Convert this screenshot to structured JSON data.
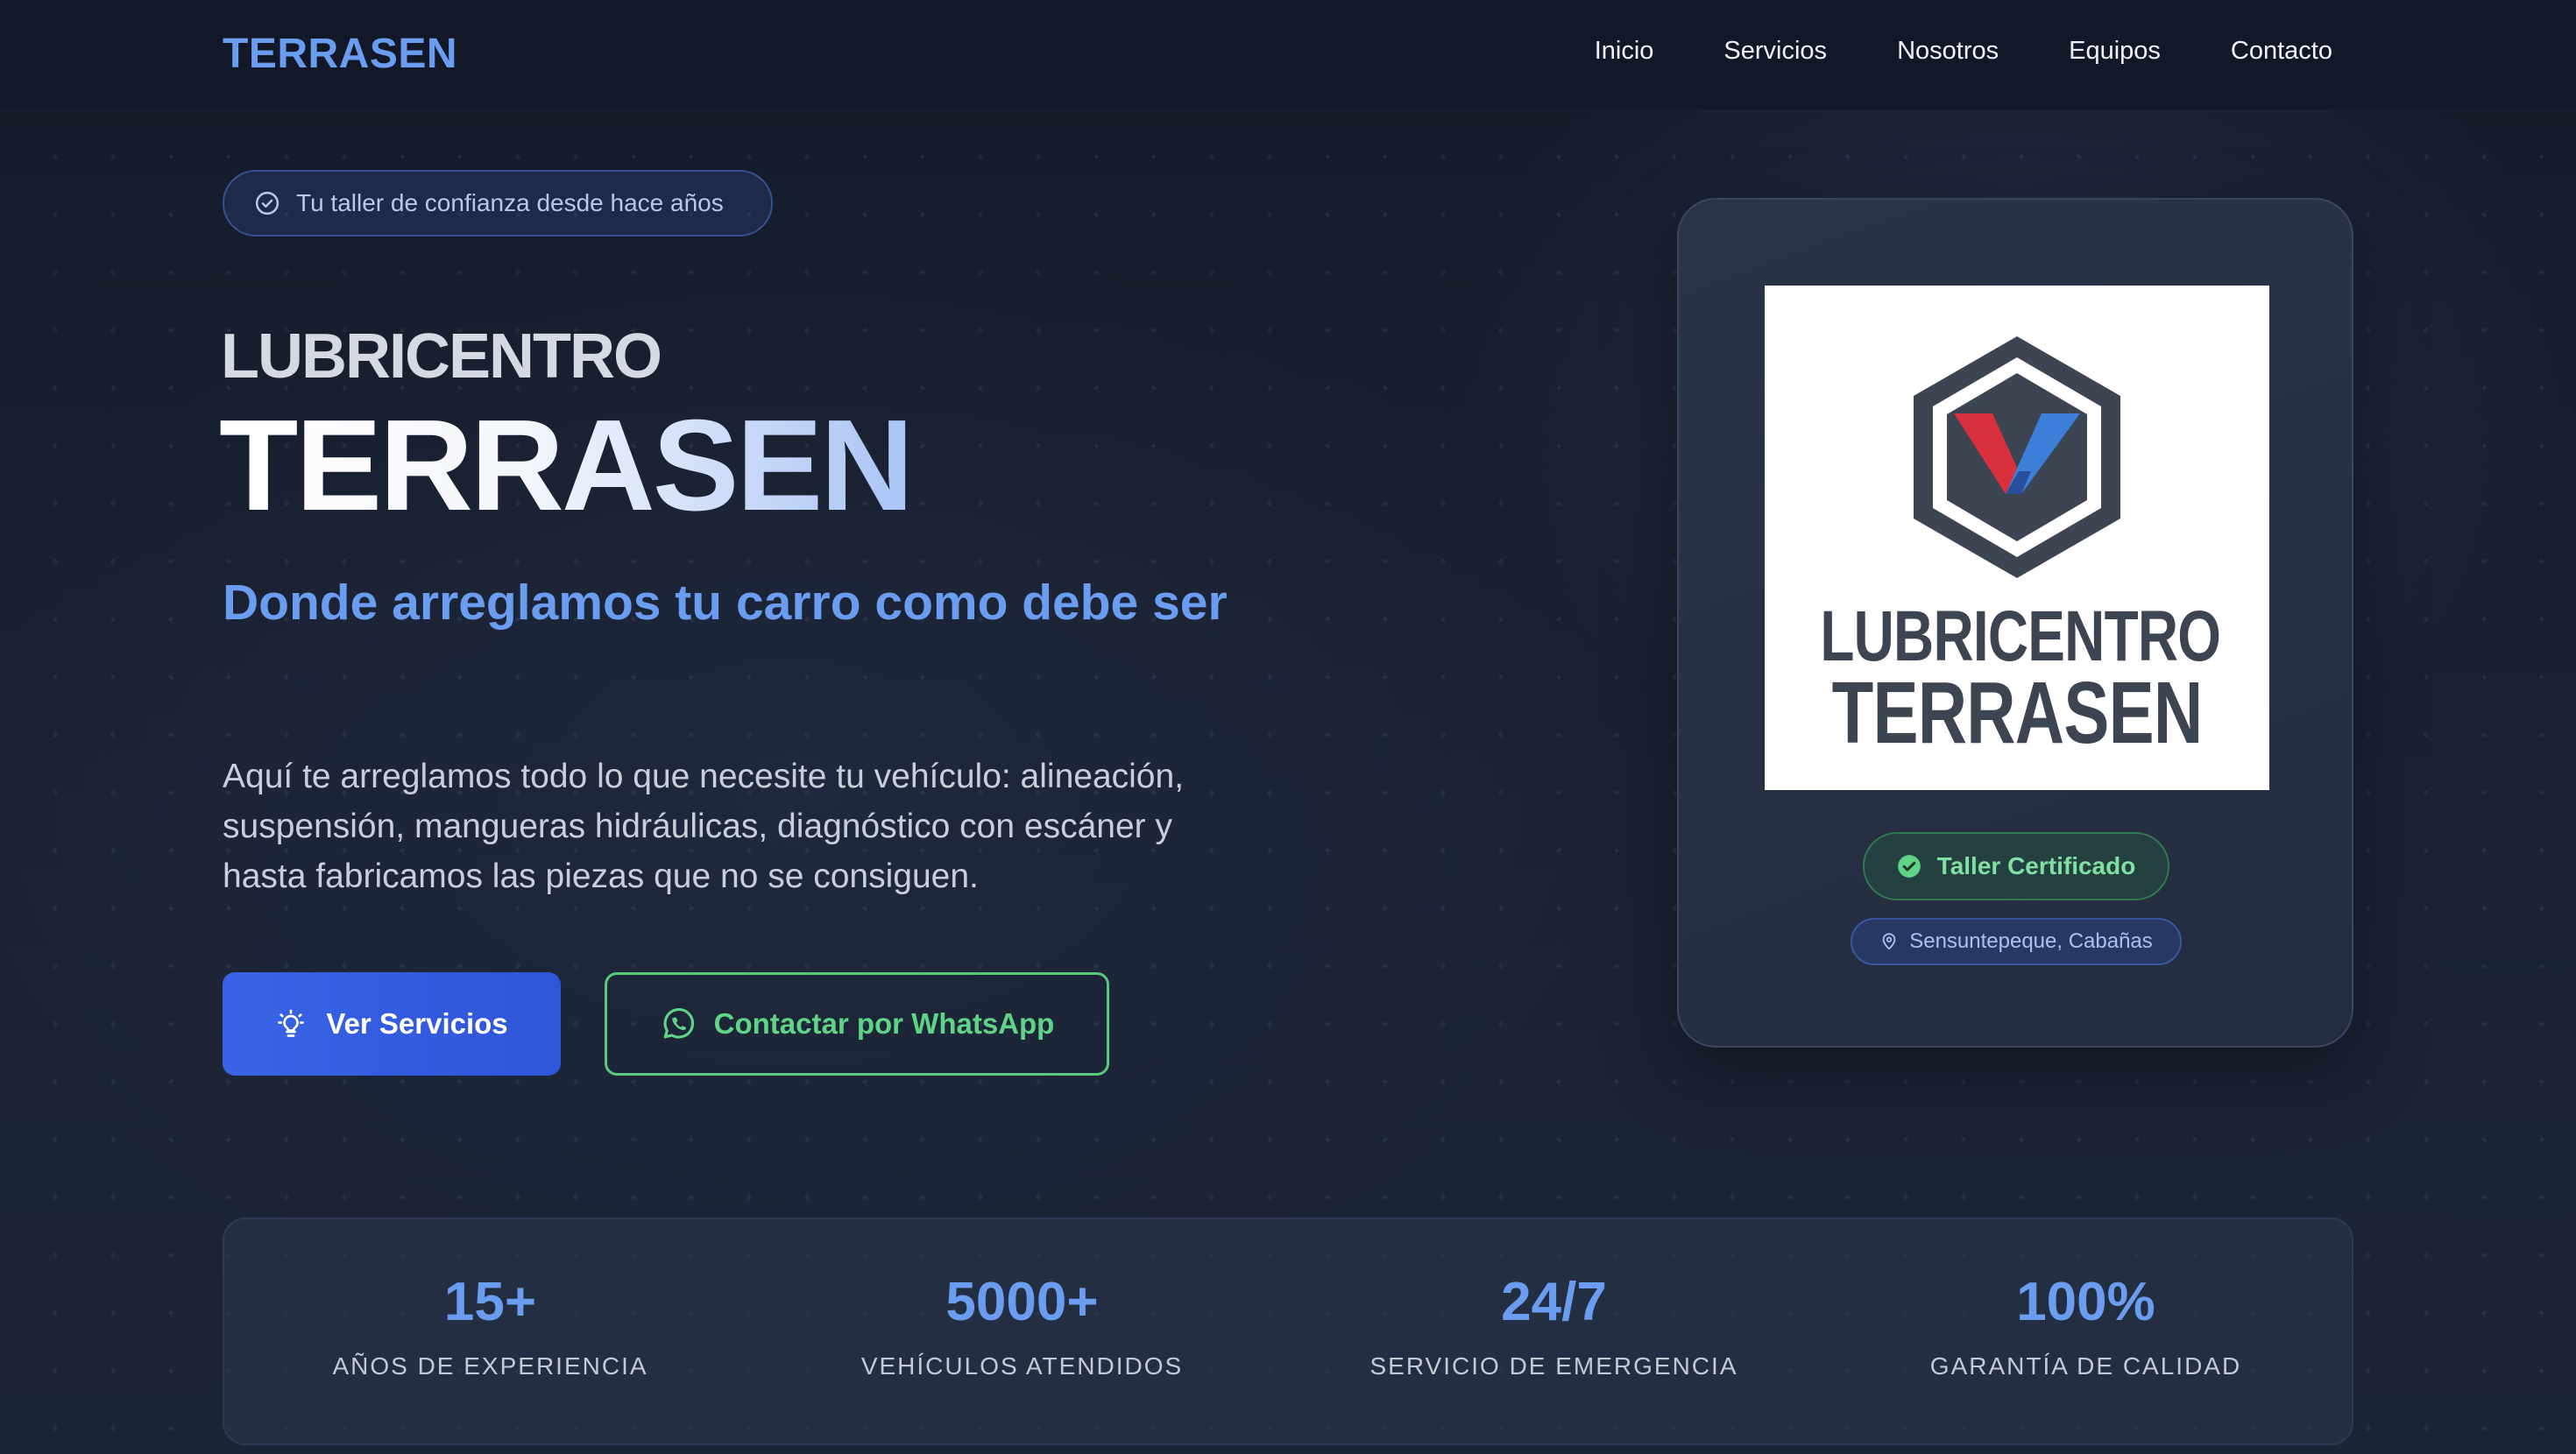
{
  "nav": {
    "brand": "TERRASEN",
    "links": [
      "Inicio",
      "Servicios",
      "Nosotros",
      "Equipos",
      "Contacto"
    ]
  },
  "hero": {
    "pill": "Tu taller de confianza desde hace años",
    "pre_title": "LUBRICENTRO",
    "title": "TERRASEN",
    "tagline": "Donde arreglamos tu carro como debe ser",
    "description": "Aquí te arreglamos todo lo que necesite tu vehículo: alineación, suspensión, mangueras hidráulicas, diagnóstico con escáner y hasta fabricamos las piezas que no se consiguen.",
    "btn_services": "Ver Servicios",
    "btn_whatsapp": "Contactar por WhatsApp"
  },
  "card": {
    "logo_line1": "LUBRICENTRO",
    "logo_line2": "TERRASEN",
    "badge_certified": "Taller Certificado",
    "badge_location": "Sensuntepeque, Cabañas"
  },
  "stats": [
    {
      "value": "15+",
      "label": "AÑOS DE EXPERIENCIA"
    },
    {
      "value": "5000+",
      "label": "VEHÍCULOS ATENDIDOS"
    },
    {
      "value": "24/7",
      "label": "SERVICIO DE EMERGENCIA"
    },
    {
      "value": "100%",
      "label": "GARANTÍA DE CALIDAD"
    }
  ],
  "colors": {
    "accent": "#6a9cf0",
    "primary_button": "#3a63e6",
    "whatsapp": "#58c97a",
    "logo_red": "#d9303e",
    "logo_blue": "#3b7fd9",
    "logo_dark": "#3d4552"
  },
  "icons": {
    "pill": "check-circle-icon",
    "services": "lightbulb-icon",
    "whatsapp": "whatsapp-icon",
    "certified": "check-badge-icon",
    "location": "map-pin-icon"
  }
}
